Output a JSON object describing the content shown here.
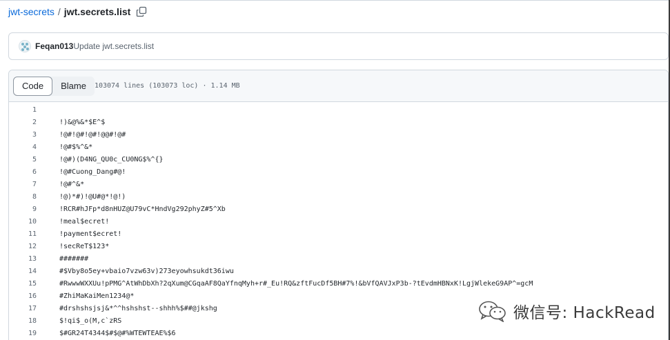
{
  "breadcrumb": {
    "repo": "jwt-secrets",
    "separator": "/",
    "file": "jwt.secrets.list",
    "copy_icon": "copy-icon"
  },
  "commit": {
    "author": "Feqan013",
    "message": "Update jwt.secrets.list"
  },
  "file_header": {
    "tabs": [
      {
        "label": "Code",
        "active": true
      },
      {
        "label": "Blame",
        "active": false
      }
    ],
    "meta": "103074 lines (103073 loc) · 1.14 MB"
  },
  "code_lines": [
    {
      "n": "1",
      "text": ""
    },
    {
      "n": "2",
      "text": "!)&@%&*$E^$"
    },
    {
      "n": "3",
      "text": "!@#!@#!@#!@@#!@#"
    },
    {
      "n": "4",
      "text": "!@#$%^&*"
    },
    {
      "n": "5",
      "text": "!@#)(D4NG_QU0c_CU0NG$%^{}"
    },
    {
      "n": "6",
      "text": "!@#Cuong_Dang#@!"
    },
    {
      "n": "7",
      "text": "!@#^&*"
    },
    {
      "n": "8",
      "text": "!@)*#)!@U#@*!@!)"
    },
    {
      "n": "9",
      "text": "!RCR#hJFp*d8nHUZ@U79vC*HndVg292phyZ#5^Xb"
    },
    {
      "n": "10",
      "text": "!meal$ecret!"
    },
    {
      "n": "11",
      "text": "!payment$ecret!"
    },
    {
      "n": "12",
      "text": "!secReT$123*"
    },
    {
      "n": "13",
      "text": "#######"
    },
    {
      "n": "14",
      "text": "#$Vby8o5ey+vbaio7vzw63v)273eyowhsukdt36iwu"
    },
    {
      "n": "15",
      "text": "#RwwwWXXUu!pPMG^AtWhDbXh?2qXum@CGqaAF8QaYfnqMyh+r#_Eu!RQ&zftFucDf5BH#7%!&bVfQAVJxP3b-?tEvdmHBNxK!LgjWlekeG9AP^=gcM"
    },
    {
      "n": "16",
      "text": "#ZhiMaKaiMen1234@*"
    },
    {
      "n": "17",
      "text": "#drshshsjsj&*^^hshshst--shhh%$##@jkshg"
    },
    {
      "n": "18",
      "text": "$!qi$_o(M,c`zRS"
    },
    {
      "n": "19",
      "text": "$#GR24T4344$#$@#%WTEWTEAE%$6"
    }
  ],
  "watermark": {
    "logo_icon": "wechat-logo-icon",
    "text": "微信号: HackRead"
  },
  "colors": {
    "link": "#0969da",
    "border": "#d0d7de",
    "header_bg": "#f6f8fa",
    "muted": "#59636e"
  }
}
